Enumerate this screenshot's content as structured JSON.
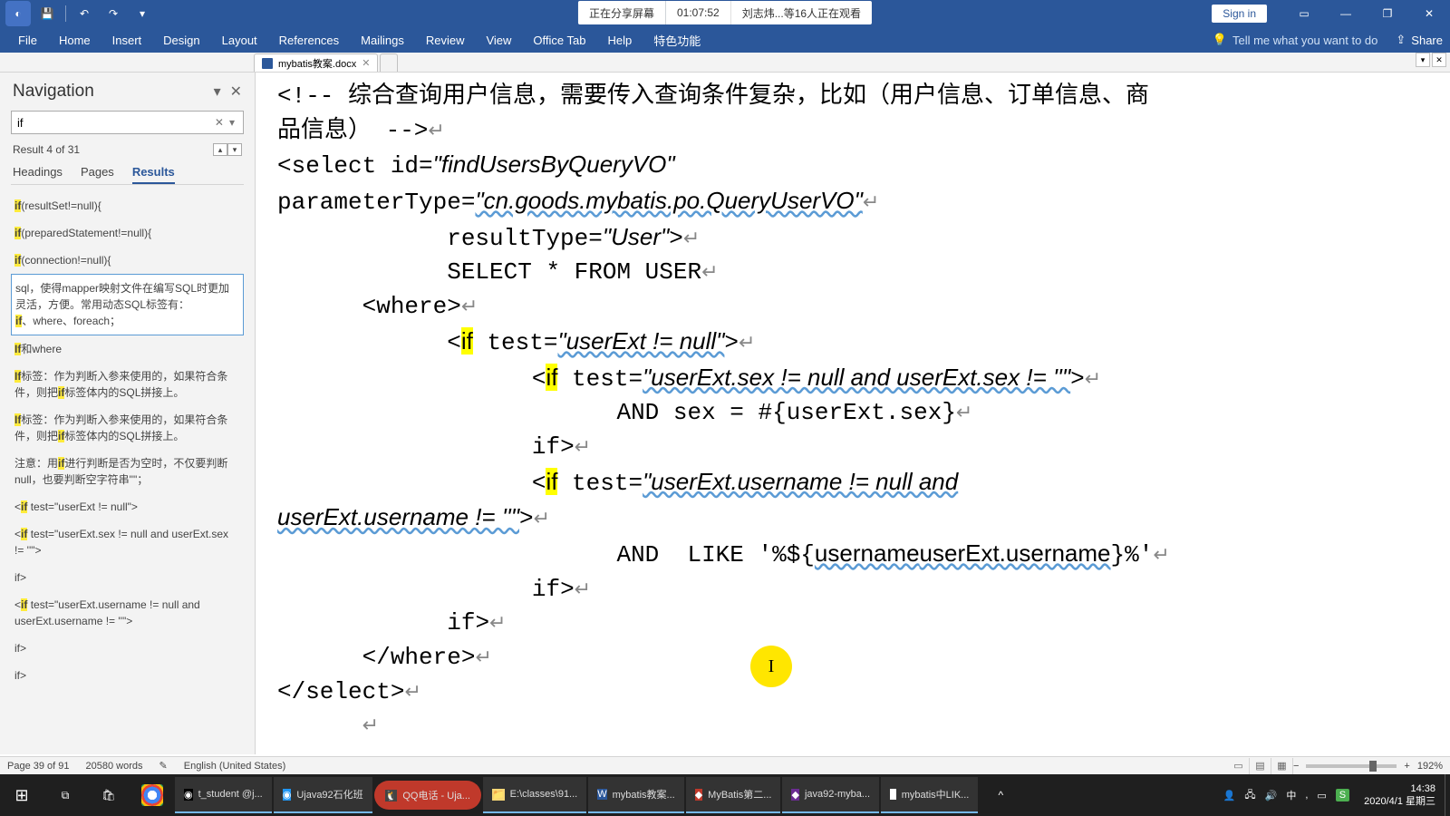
{
  "title_bar": {
    "qat": {
      "autosave": "◐",
      "save": "💾",
      "undo": "↶",
      "redo": "↷",
      "touch": "⇅"
    },
    "share_banner": {
      "seg1": "正在分享屏幕",
      "seg2": "01:07:52",
      "seg3": "刘志炜...等16人正在观看"
    },
    "sign_in": "Sign in"
  },
  "ribbon": {
    "tabs": [
      "File",
      "Home",
      "Insert",
      "Design",
      "Layout",
      "References",
      "Mailings",
      "Review",
      "View",
      "Office Tab",
      "Help",
      "特色功能"
    ],
    "tell_me": "Tell me what you want to do",
    "share": "Share"
  },
  "doc_tabs": {
    "tab1": "mybatis教案.docx"
  },
  "navigation": {
    "title": "Navigation",
    "search_value": "if",
    "result_count": "Result 4 of 31",
    "subtabs": {
      "headings": "Headings",
      "pages": "Pages",
      "results": "Results"
    },
    "results": [
      "if(resultSet!=null){",
      "if(preparedStatement!=null){",
      "if(connection!=null){",
      "sql，使得mapper映射文件在编写SQL时更加灵活，方便。常用动态SQL标签有：\nif、where、foreach；",
      "If和where",
      "If标签：作为判断入参来使用的，如果符合条件，则把if标签体内的SQL拼接上。",
      "If标签：作为判断入参来使用的，如果符合条件，则把if标签体内的SQL拼接上。",
      "注意：用if进行判断是否为空时，不仅要判断null，也要判断空字符串\"\"；",
      "<if test=\"userExt != null\">",
      "<if test=\"userExt.sex != null and userExt.sex != ''\">",
      "</if>",
      "<if test=\"userExt.username != null and userExt.username != ''\">",
      "</if>",
      "</if>"
    ]
  },
  "document": {
    "lines": [
      {
        "indent": 0,
        "pre": "<!-- 综合查询用户信息，需要传入查询条件复杂，比如（用户信息、订单信息、商"
      },
      {
        "indent": 0,
        "pre": "品信息） -->",
        "mark": "↵"
      },
      {
        "indent": 0,
        "pre": "<select id=",
        "attr": "\"findUsersByQueryVO\""
      },
      {
        "indent": 0,
        "pre": "parameterType=",
        "attr": "\"cn.goods.mybatis.po.QueryUserVO\"",
        "mark": "↵",
        "attr_ul": true
      },
      {
        "indent": 2,
        "pre": "resultType=",
        "attr": "\"User\"",
        "post": ">",
        "mark": "↵"
      },
      {
        "indent": 2,
        "pre": "SELECT * FROM USER",
        "mark": "↵"
      },
      {
        "indent": 1,
        "pre": "<where>",
        "mark": "↵"
      },
      {
        "indent": 2,
        "iftag": "<if",
        "pre2": " test=",
        "attr": "\"userExt != null\"",
        "post": ">",
        "mark": "↵",
        "attr_ul": true
      },
      {
        "indent": 3,
        "iftag": "<if",
        "pre2": " test=",
        "attr": "\"userExt.sex != null and userExt.sex != ''\"",
        "post": ">",
        "mark": "↵",
        "attr_ul": true
      },
      {
        "indent": 4,
        "pre": "AND sex = #{userExt.sex}",
        "mark": "↵",
        "ul_parts": [
          "userExt.sex"
        ]
      },
      {
        "indent": 3,
        "iftag": "</if",
        "post": ">",
        "mark": "↵"
      },
      {
        "indent": 3,
        "iftag": "<if",
        "pre2": " test=",
        "attr": "\"userExt.username != null and",
        "attr_ul": true
      },
      {
        "indent": 0,
        "attr": "userExt.username != ''\"",
        "post": ">",
        "mark": "↵",
        "attr_ul": true
      },
      {
        "indent": 4,
        "pre": "AND ",
        "ul1": "username",
        "pre2": " LIKE '%${",
        "ul2": "userExt.username",
        "post": "}%'",
        "mark": "↵"
      },
      {
        "indent": 3,
        "iftag": "</if",
        "post": ">",
        "mark": "↵"
      },
      {
        "indent": 2,
        "iftag": "</if",
        "post": ">",
        "mark": "↵"
      },
      {
        "indent": 1,
        "pre": "</where>",
        "mark": "↵"
      },
      {
        "indent": 0,
        "pre": "</select>",
        "mark": "↵"
      },
      {
        "indent": 1,
        "mark": "↵"
      }
    ]
  },
  "status_bar": {
    "page": "Page 39 of 91",
    "words": "20580 words",
    "lang": "English (United States)",
    "zoom": "192%"
  },
  "taskbar": {
    "apps": [
      {
        "icon": "◉",
        "label": "t_student @j...",
        "color": "#000"
      },
      {
        "icon": "◉",
        "label": "Ujava92石化班",
        "color": "#2196f3"
      },
      {
        "icon": "🐧",
        "label": "QQ电话 - Uja...",
        "red": true
      },
      {
        "icon": "📁",
        "label": "E:\\classes\\91...",
        "color": "#f8d775"
      },
      {
        "icon": "W",
        "label": "mybatis教案...",
        "color": "#2b579a"
      },
      {
        "icon": "◆",
        "label": "MyBatis第二...",
        "color": "#c0392b"
      },
      {
        "icon": "◆",
        "label": "java92-myba...",
        "color": "#6b2c91"
      },
      {
        "icon": "●",
        "label": "mybatis中LIK...",
        "color": "#fff"
      }
    ],
    "time": "14:38",
    "date": "2020/4/1 星期三"
  }
}
